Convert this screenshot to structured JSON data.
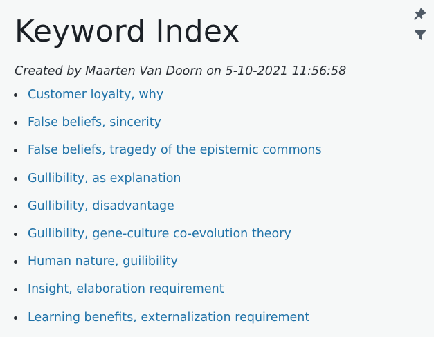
{
  "page": {
    "title": "Keyword Index",
    "byline": "Created by Maarten Van Doorn on 5-10-2021 11:56:58"
  },
  "toolbar": {
    "pin_icon": "pin-icon",
    "filter_icon": "filter-icon"
  },
  "keywords": [
    "Customer loyalty, why",
    "False beliefs, sincerity",
    "False beliefs, tragedy of the epistemic commons",
    "Gullibility, as explanation",
    "Gullibility, disadvantage",
    "Gullibility, gene-culture co-evolution theory",
    "Human nature, guilibility",
    "Insight, elaboration requirement",
    "Learning benefits, externalization requirement"
  ],
  "colors": {
    "link": "#1f72a8",
    "icon": "#4f5a66",
    "background": "#f6f8f8"
  }
}
